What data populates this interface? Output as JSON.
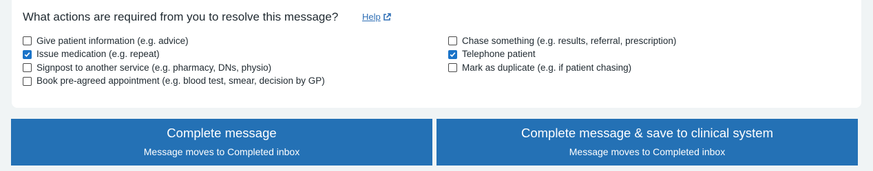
{
  "question": "What actions are required from you to resolve this message?",
  "help_link": {
    "label": "Help",
    "icon": "external-link-icon"
  },
  "options_left": [
    {
      "label": "Give patient information (e.g. advice)",
      "checked": false
    },
    {
      "label": "Issue medication (e.g. repeat)",
      "checked": true
    },
    {
      "label": "Signpost to another service (e.g. pharmacy, DNs, physio)",
      "checked": false
    },
    {
      "label": "Book pre-agreed appointment (e.g. blood test, smear, decision by GP)",
      "checked": false
    }
  ],
  "options_right": [
    {
      "label": "Chase something (e.g. results, referral, prescription)",
      "checked": false
    },
    {
      "label": "Telephone patient",
      "checked": true
    },
    {
      "label": "Mark as duplicate (e.g. if patient chasing)",
      "checked": false
    }
  ],
  "buttons": {
    "complete": {
      "title": "Complete message",
      "subtitle": "Message moves to Completed inbox"
    },
    "complete_save": {
      "title": "Complete message & save to clinical system",
      "subtitle": "Message moves to Completed inbox"
    }
  },
  "colors": {
    "button_bg": "#2471b5",
    "link": "#2f6fb5",
    "checkbox_checked": "#1a73c8"
  }
}
